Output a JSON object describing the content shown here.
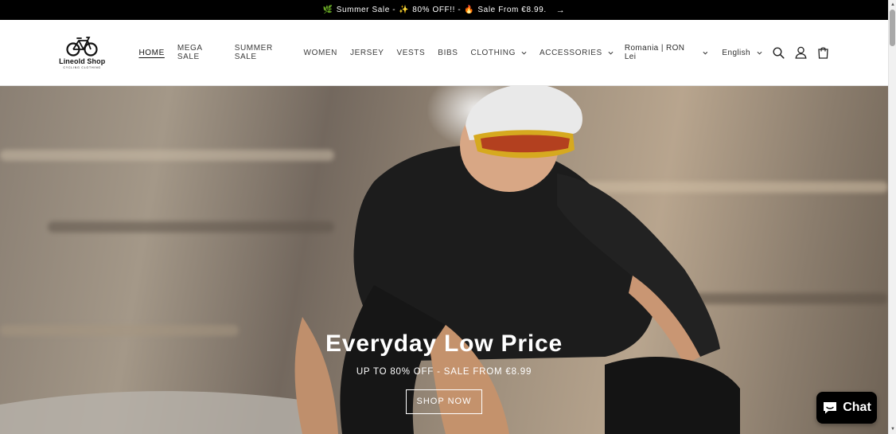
{
  "announcement": {
    "emoji1": "🌿",
    "text1": "Summer Sale -",
    "emoji2": "✨",
    "text2": "80% OFF!! -",
    "emoji3": "🔥",
    "text3": "Sale From €8.99.",
    "arrow": "→"
  },
  "logo": {
    "brand": "Lineold Shop",
    "tagline": "CYCLING CLOTHING"
  },
  "nav": {
    "items": [
      {
        "label": "HOME",
        "active": true
      },
      {
        "label": "MEGA SALE"
      },
      {
        "label": "SUMMER SALE"
      },
      {
        "label": "WOMEN"
      },
      {
        "label": "JERSEY"
      },
      {
        "label": "VESTS"
      },
      {
        "label": "BIBS"
      },
      {
        "label": "CLOTHING",
        "dropdown": true
      },
      {
        "label": "ACCESSORIES",
        "dropdown": true
      }
    ]
  },
  "header_right": {
    "country": "Romania | RON Lei",
    "language": "English",
    "icons": [
      "search-icon",
      "account-icon",
      "cart-icon"
    ]
  },
  "hero": {
    "title": "Everyday Low Price",
    "subtitle": "UP TO 80% OFF - SALE FROM €8.99",
    "button": "SHOP NOW"
  },
  "chat": {
    "label": "Chat",
    "icon": "chat-bubble-icon"
  },
  "colors": {
    "announcement_bg": "#000000",
    "hero_text": "#ffffff",
    "chat_bg": "#000000"
  }
}
